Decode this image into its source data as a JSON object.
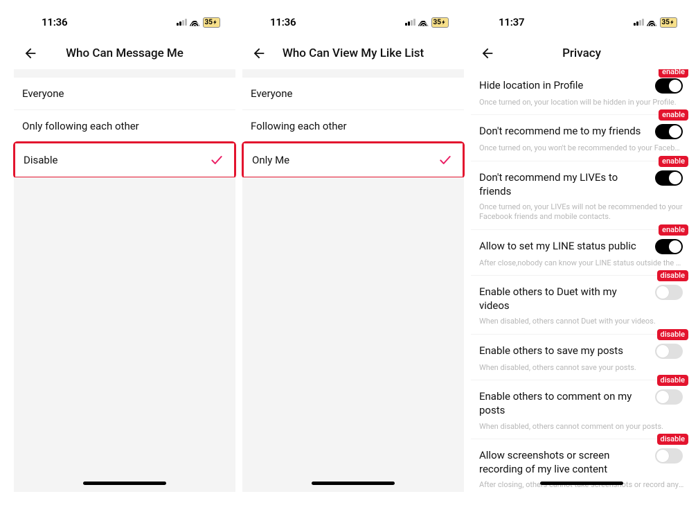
{
  "phones": {
    "left": {
      "time": "11:36",
      "battery": "35",
      "title": "Who Can Message Me",
      "options": [
        "Everyone",
        "Only following each other",
        "Disable"
      ],
      "selected_index": 2
    },
    "middle": {
      "time": "11:36",
      "battery": "35",
      "title": "Who Can View My Like List",
      "options": [
        "Everyone",
        "Following each other",
        "Only Me"
      ],
      "selected_index": 2
    },
    "right": {
      "time": "11:37",
      "battery": "35",
      "title": "Privacy",
      "annotations": {
        "enable": "enable",
        "disable": "disable"
      },
      "items": [
        {
          "label": "Hide location in Profile",
          "desc": "Once turned on, your location will be hidden in your Profile.",
          "state": "on",
          "annot": "enable",
          "wrap": false
        },
        {
          "label": "Don't recommend me to my friends",
          "desc": "Once turned on, you won't be recommended to your Facebook f...",
          "state": "on",
          "annot": "enable",
          "wrap": false
        },
        {
          "label": "Don't recommend my LIVEs to friends",
          "desc": "Once turned on, your LIVEs will not be recommended to your Facebook friends and mobile contacts.",
          "state": "on",
          "annot": "enable",
          "wrap": true
        },
        {
          "label": "Allow to set my LINE status public",
          "desc": "After close,nobody can know your LINE status outside the LIVE r...",
          "state": "on",
          "annot": "enable",
          "wrap": false
        },
        {
          "label": "Enable others to Duet with my videos",
          "desc": "When disabled, others cannot Duet with your videos.",
          "state": "off",
          "annot": "disable",
          "wrap": false
        },
        {
          "label": "Enable others to save my posts",
          "desc": "When disabled, others cannot save your posts.",
          "state": "off",
          "annot": "disable",
          "wrap": false
        },
        {
          "label": "Enable others to comment on my posts",
          "desc": "When disabled, others cannot comment on your posts.",
          "state": "off",
          "annot": "disable",
          "wrap": false
        },
        {
          "label": "Allow screenshots or screen recording of my live content",
          "desc": "After closing, others cannot take screenshots or record any of y...",
          "state": "off",
          "annot": "disable",
          "wrap": false
        }
      ]
    }
  }
}
